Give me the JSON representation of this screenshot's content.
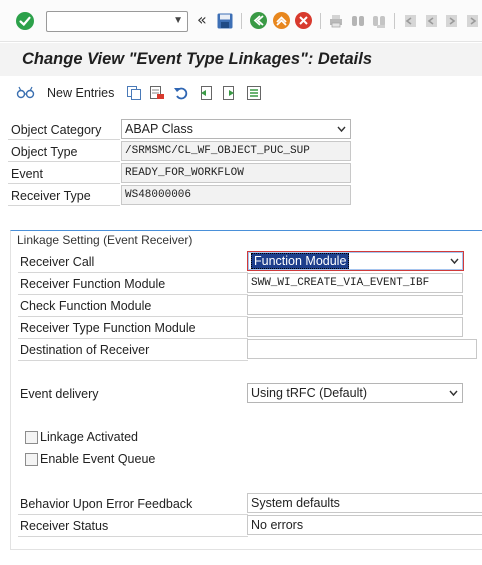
{
  "toolbar": {
    "command_field_value": "",
    "icons": [
      "enter-icon",
      "command-dropdown-icon",
      "double-left-icon",
      "save-icon",
      "back-icon",
      "exit-icon",
      "cancel-icon",
      "print-icon",
      "find-icon",
      "find-next-icon",
      "first-page-icon",
      "previous-page-icon",
      "next-page-icon",
      "last-page-icon"
    ]
  },
  "page": {
    "title": "Change View \"Event Type Linkages\": Details"
  },
  "app_toolbar": {
    "new_entries_label": "New Entries",
    "icons": [
      "glasses-icon",
      "copy-icon",
      "delete-icon",
      "undo-icon",
      "previous-entry-icon",
      "next-entry-icon",
      "select-all-icon"
    ]
  },
  "header_fields": {
    "object_category": {
      "label": "Object Category",
      "value": "ABAP Class"
    },
    "object_type": {
      "label": "Object Type",
      "value": "/SRMSMC/CL_WF_OBJECT_PUC_SUP"
    },
    "event": {
      "label": "Event",
      "value": "READY_FOR_WORKFLOW"
    },
    "receiver_type": {
      "label": "Receiver Type",
      "value": "WS48000006"
    }
  },
  "linkage": {
    "group_title": "Linkage Setting (Event Receiver)",
    "receiver_call": {
      "label": "Receiver Call",
      "value": "Function Module"
    },
    "receiver_function_module": {
      "label": "Receiver Function Module",
      "value": "SWW_WI_CREATE_VIA_EVENT_IBF"
    },
    "check_function_module": {
      "label": "Check Function Module",
      "value": ""
    },
    "receiver_type_function_module": {
      "label": "Receiver Type Function Module",
      "value": ""
    },
    "destination_of_receiver": {
      "label": "Destination of Receiver",
      "value": ""
    },
    "event_delivery": {
      "label": "Event delivery",
      "value": "Using tRFC (Default)"
    },
    "linkage_activated": {
      "label": "Linkage Activated",
      "checked": false
    },
    "enable_event_queue": {
      "label": "Enable Event Queue",
      "checked": false
    },
    "behavior_upon_error": {
      "label": "Behavior Upon Error Feedback",
      "value": "System defaults"
    },
    "receiver_status": {
      "label": "Receiver Status",
      "value": "No errors"
    }
  },
  "colors": {
    "accent_blue": "#4a90d9",
    "selection": "#1e3f8c",
    "enter_green": "#2ca14a",
    "cancel_red": "#d83a2e",
    "exit_orange": "#e8871e"
  }
}
